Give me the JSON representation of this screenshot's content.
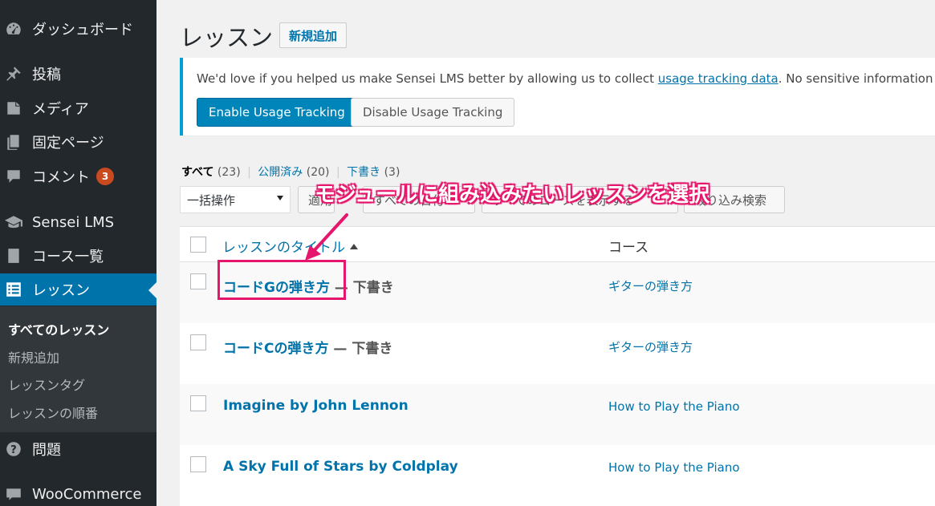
{
  "sidebar": {
    "items": [
      {
        "label": "ダッシュボード",
        "icon": "dashboard-icon"
      },
      {
        "label": "投稿",
        "icon": "pin-icon"
      },
      {
        "label": "メディア",
        "icon": "media-icon"
      },
      {
        "label": "固定ページ",
        "icon": "page-icon"
      },
      {
        "label": "コメント",
        "icon": "comment-icon",
        "badge": "3"
      },
      {
        "label": "Sensei LMS",
        "icon": "graduation-cap-icon"
      },
      {
        "label": "コース一覧",
        "icon": "book-icon"
      },
      {
        "label": "レッスン",
        "icon": "list-icon",
        "active": true
      },
      {
        "label": "問題",
        "icon": "question-icon"
      },
      {
        "label": "WooCommerce",
        "icon": "woo-icon"
      }
    ],
    "submenu": [
      "すべてのレッスン",
      "新規追加",
      "レッスンタグ",
      "レッスンの順番"
    ]
  },
  "header": {
    "title": "レッスン",
    "add_new": "新規追加"
  },
  "notice": {
    "text_before": "We'd love if you helped us make Sensei LMS better by allowing us to collect ",
    "link": "usage tracking data",
    "text_after": ". No sensitive information is colle",
    "enable_btn": "Enable Usage Tracking",
    "disable_btn": "Disable Usage Tracking"
  },
  "filters": {
    "all": "すべて",
    "all_count": "(23)",
    "published": "公開済み",
    "published_count": "(20)",
    "draft": "下書き",
    "draft_count": "(3)"
  },
  "bulk": {
    "select": "一括操作",
    "apply": "適用",
    "all_dates": "すべての日付",
    "course_filter": "すべてのコースを表示する",
    "filter_btn": "絞り込み検索"
  },
  "annotation": {
    "text": "モジュールに組み込みたいレッスンを選択"
  },
  "table": {
    "col_title": "レッスンのタイトル",
    "col_course": "コース",
    "rows": [
      {
        "title": "コードGの弾き方",
        "state": " — 下書き",
        "course": "ギターの弾き方"
      },
      {
        "title": "コードCの弾き方",
        "state": " — 下書き",
        "course": "ギターの弾き方"
      },
      {
        "title": "Imagine by John Lennon",
        "state": "",
        "course": "How to Play the Piano"
      },
      {
        "title": "A Sky Full of Stars by Coldplay",
        "state": "",
        "course": "How to Play the Piano"
      }
    ]
  },
  "colors": {
    "sidebar_bg": "#23282d",
    "accent": "#0073aa",
    "annotation": "#e5166b",
    "badge": "#ca4a1f"
  }
}
